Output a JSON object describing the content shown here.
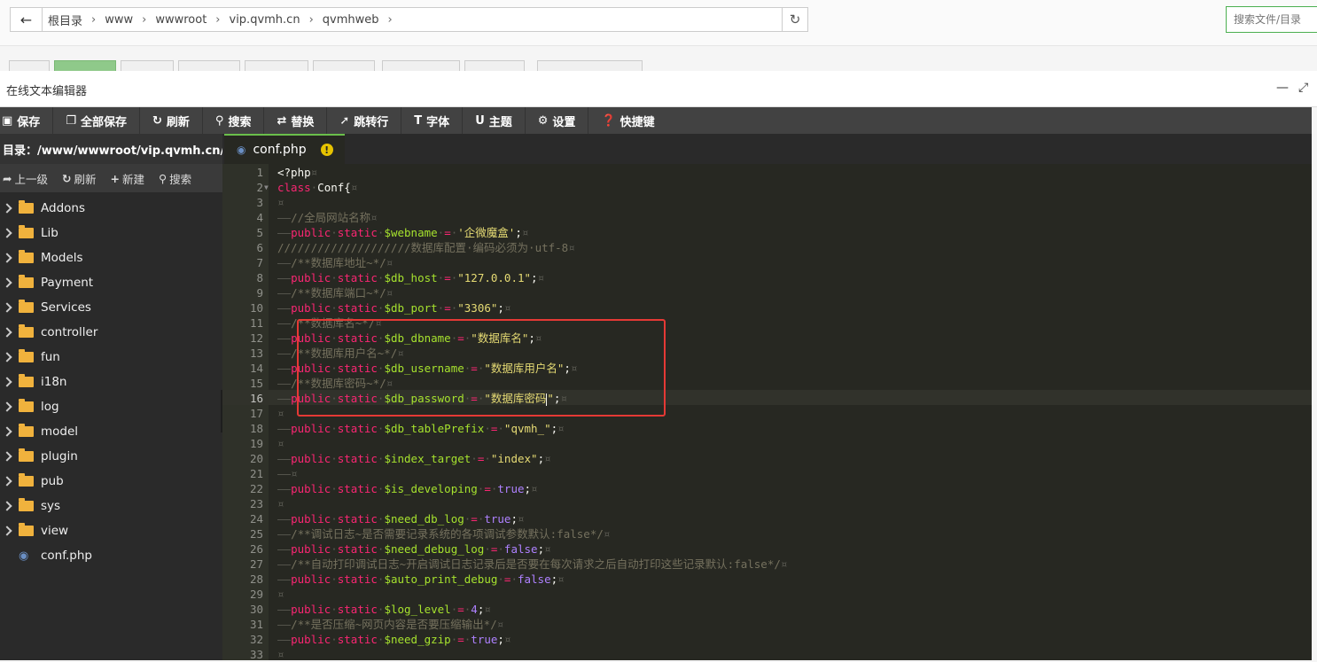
{
  "address_bar": {
    "back_icon": "arrow-left-icon",
    "breadcrumbs": [
      "根目录",
      "www",
      "wwwroot",
      "vip.qvmh.cn",
      "qvmhweb"
    ],
    "search_placeholder": "搜索文件/目录"
  },
  "editor": {
    "title": "在线文本编辑器",
    "toolbar": [
      {
        "icon": "save-icon",
        "label": "保存"
      },
      {
        "icon": "save-all-icon",
        "label": "全部保存"
      },
      {
        "icon": "refresh-icon",
        "label": "刷新"
      },
      {
        "icon": "search-icon",
        "label": "搜索"
      },
      {
        "icon": "replace-icon",
        "label": "替换"
      },
      {
        "icon": "pin-icon",
        "label": "跳转行"
      },
      {
        "icon": "font-icon",
        "label": "字体"
      },
      {
        "icon": "theme-icon",
        "label": "主题"
      },
      {
        "icon": "gear-icon",
        "label": "设置"
      },
      {
        "icon": "question-icon",
        "label": "快捷键"
      }
    ]
  },
  "sidebar": {
    "path": "目录：/www/wwwroot/vip.qvmh.cn/qv...",
    "actions": [
      {
        "icon": "share-icon",
        "label": "上一级"
      },
      {
        "icon": "refresh-icon",
        "label": "刷新"
      },
      {
        "icon": "plus-icon",
        "label": "新建"
      },
      {
        "icon": "search-icon",
        "label": "搜索"
      }
    ],
    "folders": [
      "Addons",
      "Lib",
      "Models",
      "Payment",
      "Services",
      "controller",
      "fun",
      "i18n",
      "log",
      "model",
      "plugin",
      "pub",
      "sys",
      "view"
    ],
    "files": [
      "conf.php"
    ]
  },
  "file_tab": {
    "name": "conf.php",
    "warn": "!"
  },
  "code": {
    "line_numbers": [
      "1",
      "2",
      "3",
      "4",
      "5",
      "6",
      "7",
      "8",
      "9",
      "10",
      "11",
      "12",
      "13",
      "14",
      "15",
      "16",
      "17",
      "18",
      "19",
      "20",
      "21",
      "22",
      "23",
      "24",
      "25",
      "26",
      "27",
      "28",
      "29",
      "30",
      "31",
      "32",
      "33"
    ],
    "active_line": "16",
    "lines": {
      "l1": "<?php",
      "l2a": "class",
      "l2b": "Conf{",
      "l4": "//全局网站名称",
      "l5var": "$webname",
      "l5str": "'企微魔盒'",
      "l6": "////////////////////数据库配置·编码必须为·utf-8",
      "l7": "/**数据库地址~*/",
      "l8var": "$db_host",
      "l8str": "\"127.0.0.1\"",
      "l9": "/**数据库端口~*/",
      "l10var": "$db_port",
      "l10str": "\"3306\"",
      "l11": "/**数据库名~*/",
      "l12var": "$db_dbname",
      "l12str": "\"数据库名\"",
      "l13": "/**数据库用户名~*/",
      "l14var": "$db_username",
      "l14str": "\"数据库用户名\"",
      "l15": "/**数据库密码~*/",
      "l16var": "$db_password",
      "l16str_a": "\"数据库密码",
      "l16str_b": "\"",
      "l18var": "$db_tablePrefix",
      "l18str": "\"qvmh_\"",
      "l20var": "$index_target",
      "l20str": "\"index\"",
      "l22var": "$is_developing",
      "l22val": "true",
      "l24var": "$need_db_log",
      "l24val": "true",
      "l25": "/**调试日志~是否需要记录系统的各项调试参数默认:false*/",
      "l26var": "$need_debug_log",
      "l26val": "false",
      "l27": "/**自动打印调试日志~开启调试日志记录后是否要在每次请求之后自动打印这些记录默认:false*/",
      "l28var": "$auto_print_debug",
      "l28val": "false",
      "l30var": "$log_level",
      "l30val": "4",
      "l31": "/**是否压缩~网页内容是否要压缩输出*/",
      "l32var": "$need_gzip",
      "l32val": "true"
    },
    "kw_public": "public",
    "kw_static": "static"
  },
  "colors": {
    "accent_green": "#6abf4b",
    "highlight_red": "#e53935",
    "editor_bg": "#272822"
  }
}
